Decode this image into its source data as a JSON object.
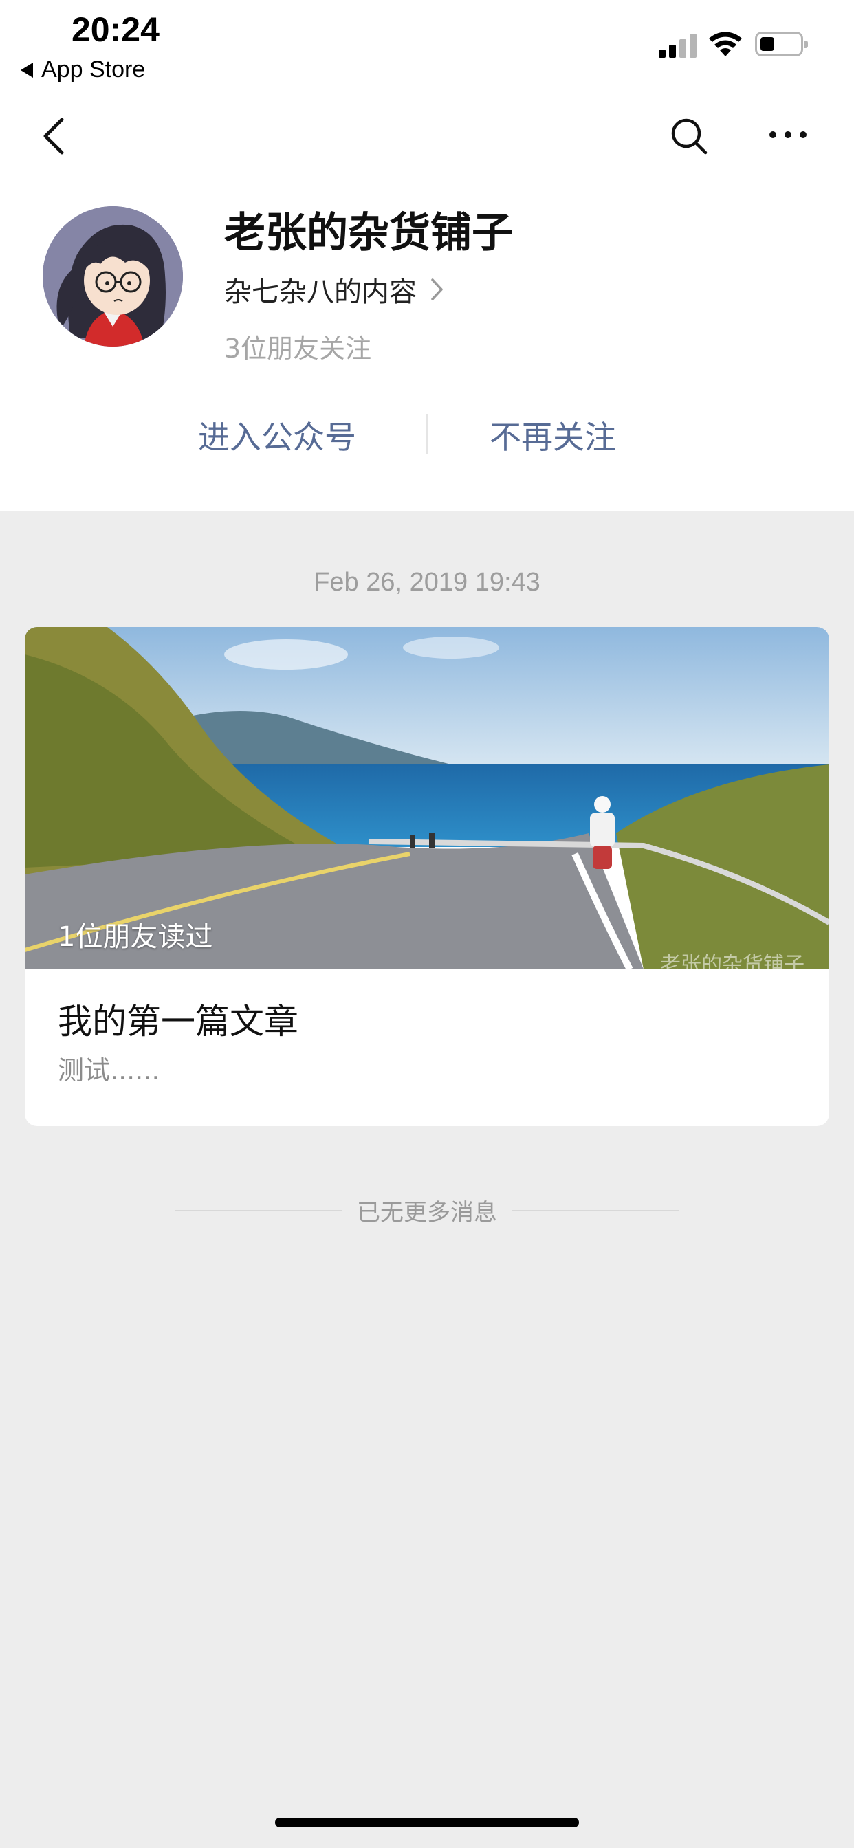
{
  "status_bar": {
    "time": "20:24",
    "back_app": "App Store"
  },
  "nav": {
    "icons": [
      "back-arrow-icon",
      "search-icon",
      "more-icon"
    ]
  },
  "profile": {
    "name": "老张的杂货铺子",
    "description": "杂七杂八的内容",
    "followers": "3位朋友关注"
  },
  "actions": {
    "enter": "进入公众号",
    "unfollow": "不再关注"
  },
  "feed": {
    "date": "Feb 26, 2019 19:43",
    "article": {
      "read_badge": "1位朋友读过",
      "watermark": "老张的杂货铺子",
      "title": "我的第一篇文章",
      "digest": "测试......"
    },
    "end_text": "已无更多消息"
  },
  "colors": {
    "link": "#576b95",
    "page_bg": "#ededed"
  }
}
